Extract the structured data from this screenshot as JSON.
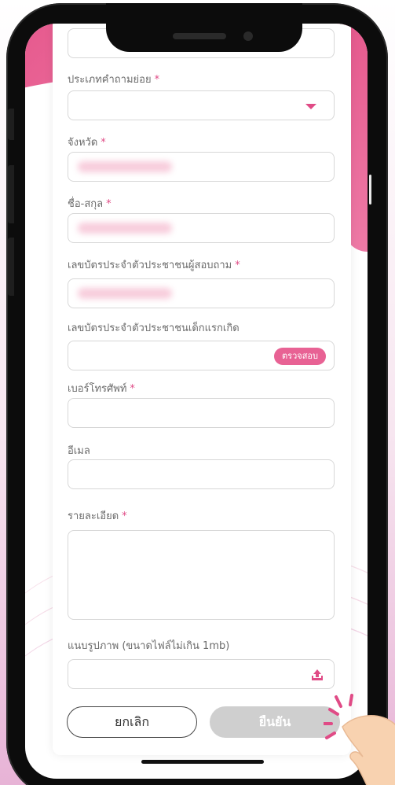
{
  "form": {
    "subcategory_label": "ประเภทคำถามย่อย",
    "province_label": "จังหวัด",
    "fullname_label": "ชื่อ-สกุล",
    "asker_id_label": "เลขบัตรประจำตัวประชาชนผู้สอบถาม",
    "newborn_id_label": "เลขบัตรประจำตัวประชาชนเด็กแรกเกิด",
    "check_button": "ตรวจสอบ",
    "phone_label": "เบอร์โทรศัพท์",
    "email_label": "อีเมล",
    "details_label": "รายละเอียด",
    "attach_label": "แนบรูปภาพ (ขนาดไฟล์ไม่เกิน 1mb)",
    "required_mark": "*"
  },
  "actions": {
    "cancel_label": "ยกเลิก",
    "confirm_label": "ยืนยัน"
  },
  "colors": {
    "accent": "#e04b86",
    "pink_band": "#e65a8e",
    "disabled_button": "#cfcfcf"
  },
  "icons": {
    "dropdown": "caret-down-icon",
    "upload": "upload-icon",
    "hand": "pointing-hand-icon"
  }
}
